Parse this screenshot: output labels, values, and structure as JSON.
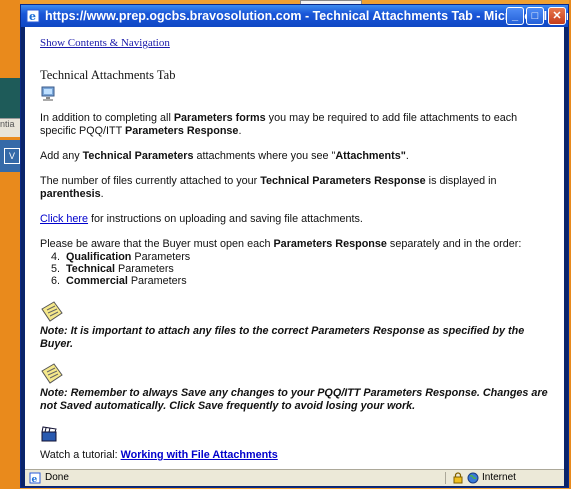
{
  "window": {
    "title": "https://www.prep.ogcbs.bravosolution.com - Technical Attachments Tab - Microsoft Internet Expl...",
    "minimize": "_",
    "maximize": "□",
    "close": "✕"
  },
  "background": {
    "strip_text": "ntia",
    "strip_button": "V"
  },
  "content": {
    "nav_link": "Show Contents & Navigation",
    "heading": "Technical Attachments Tab",
    "p1_a": "In addition to completing all ",
    "p1_b": "Parameters forms",
    "p1_c": " you may be required to add file attachments to each specific PQQ/ITT ",
    "p1_d": "Parameters Response",
    "p1_e": ".",
    "p2_a": "Add any ",
    "p2_b": "Technical Parameters",
    "p2_c": " attachments where you see \"",
    "p2_d": "Attachments\"",
    "p2_e": ".",
    "p3_a": "The number of files currently attached to your ",
    "p3_b": "Technical Parameters Response",
    "p3_c": " is displayed in ",
    "p3_d": "parenthesis",
    "p3_e": ".",
    "p4_link": "Click here",
    "p4_rest": " for instructions on uploading and saving file attachments.",
    "p5_a": "Please be aware that the Buyer must open each ",
    "p5_b": "Parameters Response",
    "p5_c": " separately and in the order:",
    "list": [
      {
        "num": "4.",
        "bold": "Qualification",
        "rest": " Parameters"
      },
      {
        "num": "5.",
        "bold": "Technical",
        "rest": " Parameters"
      },
      {
        "num": "6.",
        "bold": "Commercial",
        "rest": " Parameters"
      }
    ],
    "note1": "Note: It is important to attach any files to the correct Parameters Response as specified by the Buyer.",
    "note2": "Note: Remember to always Save any changes to your PQQ/ITT Parameters Response. Changes are not Saved automatically. Click Save frequently to avoid losing your work.",
    "tutorial_text": "Watch a tutorial: ",
    "tutorial_link": "Working with File Attachments"
  },
  "statusbar": {
    "status": "Done",
    "zone": "Internet"
  }
}
